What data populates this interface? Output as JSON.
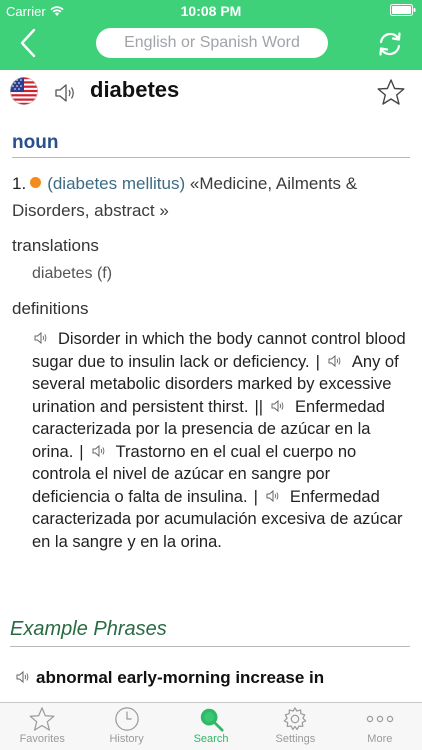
{
  "status_bar": {
    "carrier": "Carrier",
    "time": "10:08 PM"
  },
  "header": {
    "search_placeholder": "English or Spanish Word",
    "accent_color": "#3fd07a"
  },
  "entry": {
    "headword": "diabetes",
    "part_of_speech": "noun",
    "sense": {
      "number": "1.",
      "link_text": "(diabetes mellitus)",
      "categories": "«Medicine, Ailments & Disorders, abstract »"
    },
    "translations_label": "translations",
    "translation": "diabetes (f)",
    "definitions_label": "definitions",
    "definitions": [
      "Disorder in which the body cannot control blood sugar due to insulin lack or deficiency.",
      "Any of several metabolic disorders marked by excessive urination and persistent thirst.",
      "Enfermedad caracterizada por la presencia de azúcar en la orina.",
      "Trastorno en el cual el cuerpo no controla el nivel de azúcar en sangre por deficiencia o falta de insulina.",
      "Enfermedad caracterizada por acumulación excesiva de azúcar en la sangre y en la orina."
    ],
    "separators": [
      "|",
      "||",
      "|",
      "|"
    ]
  },
  "examples": {
    "title": "Example Phrases",
    "first_phrase": "abnormal early-morning increase in"
  },
  "tabs": [
    {
      "label": "Favorites",
      "icon": "star-icon",
      "active": false
    },
    {
      "label": "History",
      "icon": "clock-icon",
      "active": false
    },
    {
      "label": "Search",
      "icon": "search-icon",
      "active": true
    },
    {
      "label": "Settings",
      "icon": "gear-icon",
      "active": false
    },
    {
      "label": "More",
      "icon": "more-icon",
      "active": false
    }
  ],
  "colors": {
    "active_tab": "#2fb866",
    "sense_dot": "#f28c1e",
    "part_of_speech": "#2b4f8a",
    "example_title": "#2a6a43"
  }
}
